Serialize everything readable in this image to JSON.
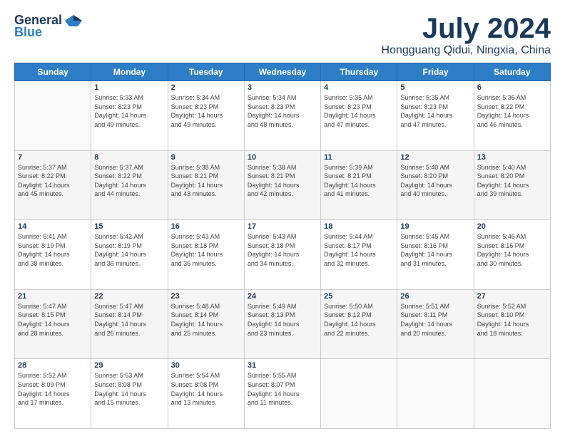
{
  "logo": {
    "general": "General",
    "blue": "Blue"
  },
  "header": {
    "title": "July 2024",
    "subtitle": "Hongguang Qidui, Ningxia, China"
  },
  "weekdays": [
    "Sunday",
    "Monday",
    "Tuesday",
    "Wednesday",
    "Thursday",
    "Friday",
    "Saturday"
  ],
  "weeks": [
    [
      {
        "day": "",
        "sunrise": "",
        "sunset": "",
        "daylight": ""
      },
      {
        "day": "1",
        "sunrise": "Sunrise: 5:33 AM",
        "sunset": "Sunset: 8:23 PM",
        "daylight": "Daylight: 14 hours and 49 minutes."
      },
      {
        "day": "2",
        "sunrise": "Sunrise: 5:34 AM",
        "sunset": "Sunset: 8:23 PM",
        "daylight": "Daylight: 14 hours and 49 minutes."
      },
      {
        "day": "3",
        "sunrise": "Sunrise: 5:34 AM",
        "sunset": "Sunset: 8:23 PM",
        "daylight": "Daylight: 14 hours and 48 minutes."
      },
      {
        "day": "4",
        "sunrise": "Sunrise: 5:35 AM",
        "sunset": "Sunset: 8:23 PM",
        "daylight": "Daylight: 14 hours and 47 minutes."
      },
      {
        "day": "5",
        "sunrise": "Sunrise: 5:35 AM",
        "sunset": "Sunset: 8:23 PM",
        "daylight": "Daylight: 14 hours and 47 minutes."
      },
      {
        "day": "6",
        "sunrise": "Sunrise: 5:36 AM",
        "sunset": "Sunset: 8:22 PM",
        "daylight": "Daylight: 14 hours and 46 minutes."
      }
    ],
    [
      {
        "day": "7",
        "sunrise": "Sunrise: 5:37 AM",
        "sunset": "Sunset: 8:22 PM",
        "daylight": "Daylight: 14 hours and 45 minutes."
      },
      {
        "day": "8",
        "sunrise": "Sunrise: 5:37 AM",
        "sunset": "Sunset: 8:22 PM",
        "daylight": "Daylight: 14 hours and 44 minutes."
      },
      {
        "day": "9",
        "sunrise": "Sunrise: 5:38 AM",
        "sunset": "Sunset: 8:21 PM",
        "daylight": "Daylight: 14 hours and 43 minutes."
      },
      {
        "day": "10",
        "sunrise": "Sunrise: 5:38 AM",
        "sunset": "Sunset: 8:21 PM",
        "daylight": "Daylight: 14 hours and 42 minutes."
      },
      {
        "day": "11",
        "sunrise": "Sunrise: 5:39 AM",
        "sunset": "Sunset: 8:21 PM",
        "daylight": "Daylight: 14 hours and 41 minutes."
      },
      {
        "day": "12",
        "sunrise": "Sunrise: 5:40 AM",
        "sunset": "Sunset: 8:20 PM",
        "daylight": "Daylight: 14 hours and 40 minutes."
      },
      {
        "day": "13",
        "sunrise": "Sunrise: 5:40 AM",
        "sunset": "Sunset: 8:20 PM",
        "daylight": "Daylight: 14 hours and 39 minutes."
      }
    ],
    [
      {
        "day": "14",
        "sunrise": "Sunrise: 5:41 AM",
        "sunset": "Sunset: 8:19 PM",
        "daylight": "Daylight: 14 hours and 38 minutes."
      },
      {
        "day": "15",
        "sunrise": "Sunrise: 5:42 AM",
        "sunset": "Sunset: 8:19 PM",
        "daylight": "Daylight: 14 hours and 36 minutes."
      },
      {
        "day": "16",
        "sunrise": "Sunrise: 5:43 AM",
        "sunset": "Sunset: 8:18 PM",
        "daylight": "Daylight: 14 hours and 35 minutes."
      },
      {
        "day": "17",
        "sunrise": "Sunrise: 5:43 AM",
        "sunset": "Sunset: 8:18 PM",
        "daylight": "Daylight: 14 hours and 34 minutes."
      },
      {
        "day": "18",
        "sunrise": "Sunrise: 5:44 AM",
        "sunset": "Sunset: 8:17 PM",
        "daylight": "Daylight: 14 hours and 32 minutes."
      },
      {
        "day": "19",
        "sunrise": "Sunrise: 5:45 AM",
        "sunset": "Sunset: 8:16 PM",
        "daylight": "Daylight: 14 hours and 31 minutes."
      },
      {
        "day": "20",
        "sunrise": "Sunrise: 5:46 AM",
        "sunset": "Sunset: 8:16 PM",
        "daylight": "Daylight: 14 hours and 30 minutes."
      }
    ],
    [
      {
        "day": "21",
        "sunrise": "Sunrise: 5:47 AM",
        "sunset": "Sunset: 8:15 PM",
        "daylight": "Daylight: 14 hours and 28 minutes."
      },
      {
        "day": "22",
        "sunrise": "Sunrise: 5:47 AM",
        "sunset": "Sunset: 8:14 PM",
        "daylight": "Daylight: 14 hours and 26 minutes."
      },
      {
        "day": "23",
        "sunrise": "Sunrise: 5:48 AM",
        "sunset": "Sunset: 8:14 PM",
        "daylight": "Daylight: 14 hours and 25 minutes."
      },
      {
        "day": "24",
        "sunrise": "Sunrise: 5:49 AM",
        "sunset": "Sunset: 8:13 PM",
        "daylight": "Daylight: 14 hours and 23 minutes."
      },
      {
        "day": "25",
        "sunrise": "Sunrise: 5:50 AM",
        "sunset": "Sunset: 8:12 PM",
        "daylight": "Daylight: 14 hours and 22 minutes."
      },
      {
        "day": "26",
        "sunrise": "Sunrise: 5:51 AM",
        "sunset": "Sunset: 8:11 PM",
        "daylight": "Daylight: 14 hours and 20 minutes."
      },
      {
        "day": "27",
        "sunrise": "Sunrise: 5:52 AM",
        "sunset": "Sunset: 8:10 PM",
        "daylight": "Daylight: 14 hours and 18 minutes."
      }
    ],
    [
      {
        "day": "28",
        "sunrise": "Sunrise: 5:52 AM",
        "sunset": "Sunset: 8:09 PM",
        "daylight": "Daylight: 14 hours and 17 minutes."
      },
      {
        "day": "29",
        "sunrise": "Sunrise: 5:53 AM",
        "sunset": "Sunset: 8:08 PM",
        "daylight": "Daylight: 14 hours and 15 minutes."
      },
      {
        "day": "30",
        "sunrise": "Sunrise: 5:54 AM",
        "sunset": "Sunset: 8:08 PM",
        "daylight": "Daylight: 14 hours and 13 minutes."
      },
      {
        "day": "31",
        "sunrise": "Sunrise: 5:55 AM",
        "sunset": "Sunset: 8:07 PM",
        "daylight": "Daylight: 14 hours and 11 minutes."
      },
      {
        "day": "",
        "sunrise": "",
        "sunset": "",
        "daylight": ""
      },
      {
        "day": "",
        "sunrise": "",
        "sunset": "",
        "daylight": ""
      },
      {
        "day": "",
        "sunrise": "",
        "sunset": "",
        "daylight": ""
      }
    ]
  ]
}
